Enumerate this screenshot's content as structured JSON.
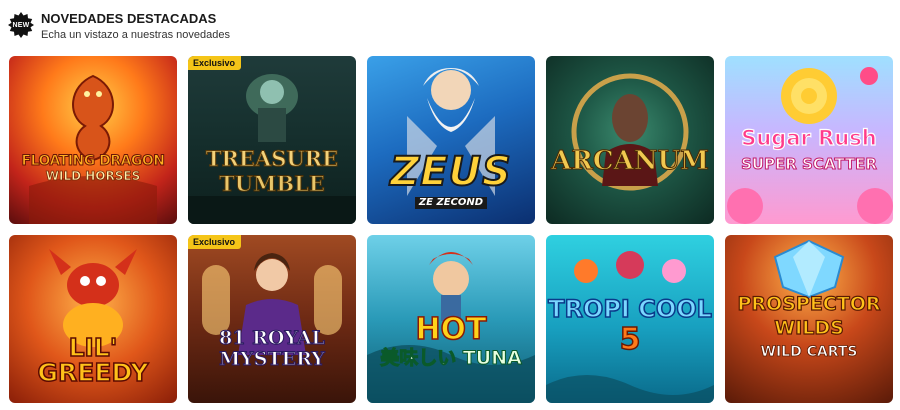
{
  "header": {
    "badge_label": "NEW",
    "title": "NOVEDADES DESTACADAS",
    "subtitle": "Echa un vistazo a nuestras novedades"
  },
  "badge_exclusive_label": "Exclusivo",
  "games": [
    {
      "line1": "FLOATING DRAGON",
      "line2": "WILD HORSES",
      "exclusive": false
    },
    {
      "line1": "TREASURE",
      "line2": "TUMBLE",
      "exclusive": true
    },
    {
      "line1": "ZEUS",
      "line2": "ZE ZECOND",
      "exclusive": false
    },
    {
      "line1": "ARCANUM",
      "line2": "",
      "exclusive": false
    },
    {
      "line1": "Sugar Rush",
      "line2": "SUPER SCATTER",
      "exclusive": false
    },
    {
      "line1": "LIL' GREEDY",
      "line2": "",
      "exclusive": false
    },
    {
      "line1": "81 ROYAL",
      "line2": "MYSTERY",
      "exclusive": true
    },
    {
      "line1": "HOT",
      "line2": "美味しい TUNA",
      "exclusive": false
    },
    {
      "line1": "TROPI COOL",
      "line2": "5",
      "exclusive": false
    },
    {
      "line1": "PROSPECTOR WILDS",
      "line2": "WILD CARTS",
      "exclusive": false
    }
  ],
  "colors": {
    "exclusive_badge": "#f5c518",
    "background": "#ffffff"
  }
}
